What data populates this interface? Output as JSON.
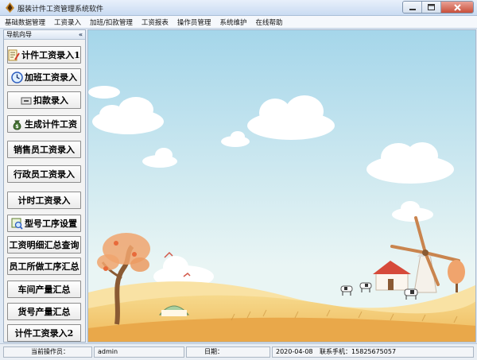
{
  "window": {
    "title": "服装计件工资管理系统软件",
    "controls": [
      "minimize",
      "maximize",
      "close"
    ]
  },
  "menu": {
    "items": [
      "基础数据管理",
      "工资录入",
      "加班/扣款管理",
      "工资报表",
      "操作员管理",
      "系统维护",
      "在线帮助"
    ]
  },
  "sidebar": {
    "title": "导航向导",
    "collapse_glyph": "«",
    "buttons": [
      {
        "label": "计件工资录入1",
        "icon": "edit-form-icon"
      },
      {
        "label": "加班工资录入",
        "icon": "clock-icon"
      },
      {
        "label": "扣款录入",
        "icon": "minus-keyboard-icon"
      },
      {
        "label": "生成计件工资",
        "icon": "money-bag-icon"
      },
      {
        "label": "销售员工资录入",
        "icon": ""
      },
      {
        "label": "行政员工资录入",
        "icon": ""
      },
      {
        "label": "计时工资录入",
        "icon": ""
      },
      {
        "label": "型号工序设置",
        "icon": "settings-search-icon"
      },
      {
        "label": "工资明细汇总查询",
        "icon": ""
      },
      {
        "label": "员工所做工序汇总",
        "icon": ""
      },
      {
        "label": "车间产量汇总",
        "icon": ""
      },
      {
        "label": "货号产量汇总",
        "icon": ""
      },
      {
        "label": "计件工资录入2",
        "icon": ""
      }
    ]
  },
  "status": {
    "operator_label": "当前操作员：",
    "operator_value": "admin",
    "date_label": "日期：",
    "date_value": "2020-04-08",
    "phone_text": "联系手机：15825675057"
  },
  "colors": {
    "sky_top": "#a5d6ea",
    "sky_bottom": "#e9f5f4",
    "field": "#f3c76b",
    "titlebar": "#c9dbf2"
  }
}
